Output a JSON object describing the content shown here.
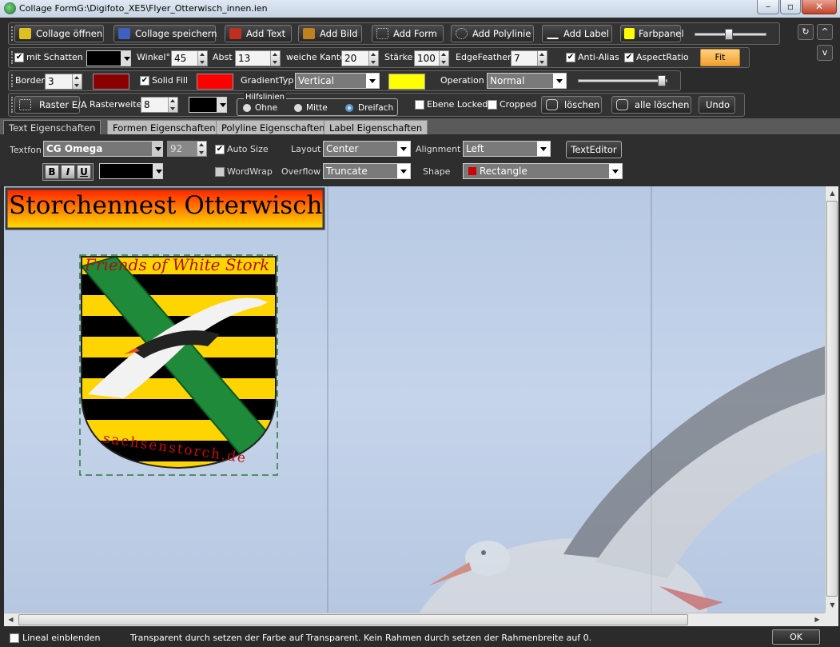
{
  "window": {
    "title": "Collage FormG:\\Digifoto_XE5\\Flyer_Otterwisch_innen.ien"
  },
  "toolbar1": {
    "open": "Collage öffnen",
    "save": "Collage speichern",
    "add_text": "Add Text",
    "add_image": "Add Bild",
    "add_form": "Add Form",
    "add_polyline": "Add Polylinie",
    "add_label": "Add Label",
    "colorpanel": "Farbpanel",
    "colorpanel_color": "#ffff00"
  },
  "toolbar2": {
    "shadow_label": "mit Schatten",
    "shadow_checked": "✔",
    "angle_label": "Winkel°",
    "angle_value": "45",
    "distance_label": "Abst",
    "distance_value": "13",
    "softedge_label": "weiche Kante",
    "softedge_value": "20",
    "strength_label": "Stärke",
    "strength_value": "100",
    "feather_label": "EdgeFeather",
    "feather_value": "7",
    "antialias_label": "Anti-Alias",
    "antialias_checked": "✔",
    "aspect_label": "AspectRatio",
    "aspect_checked": "✔",
    "fit": "Fit",
    "shadow_color": "#000000"
  },
  "toolbar3": {
    "border_label": "Border",
    "border_value": "3",
    "border_color": "#8b0000",
    "solidfill_label": "Solid Fill",
    "solidfill_checked": "✔",
    "fill_color": "#ff0000",
    "gradient_label": "GradientTyp",
    "gradient_value": "Vertical",
    "gradient_color": "#ffff00",
    "operation_label": "Operation",
    "operation_value": "Normal"
  },
  "toolbar4": {
    "grid_button": "Raster E/A",
    "gridwidth_label": "Rasterweite",
    "gridwidth_value": "8",
    "guides_label": "Hilfslinien",
    "guide_none": "Ohne",
    "guide_middle": "Mitte",
    "guide_triple": "Dreifach",
    "locked_label": "Ebene Locked",
    "cropped_label": "Cropped",
    "delete": "löschen",
    "delete_all": "alle löschen",
    "undo": "Undo",
    "grid_color": "#000000"
  },
  "tabs": [
    "Text Eigenschaften",
    "Formen Eigenschaften",
    "Polyline Eigenschaften",
    "Label Eigenschaften"
  ],
  "textprops": {
    "font_label": "Textfon",
    "font_value": "CG Omega",
    "size_value": "92",
    "autosize_label": "Auto Size",
    "autosize_checked": "✔",
    "layout_label": "Layout",
    "layout_value": "Center",
    "alignment_label": "Alignment",
    "alignment_value": "Left",
    "texteditor": "TextEditor",
    "bold": "B",
    "italic": "I",
    "underline": "U",
    "wordwrap_label": "WordWrap",
    "overflow_label": "Overflow",
    "overflow_value": "Truncate",
    "shape_label": "Shape",
    "shape_value": "Rectangle",
    "shape_color": "#cc0000"
  },
  "canvas": {
    "headline": "Storchennest Otterwisch",
    "crest_top": "Friends of White Stork",
    "crest_bottom": "sachsenstorch.de"
  },
  "status": {
    "ruler_label": "Lineal einblenden",
    "message": "Transparent durch setzen der Farbe auf Transparent. Kein Rahmen durch setzen der Rahmenbreite auf  0.",
    "ok": "OK"
  }
}
